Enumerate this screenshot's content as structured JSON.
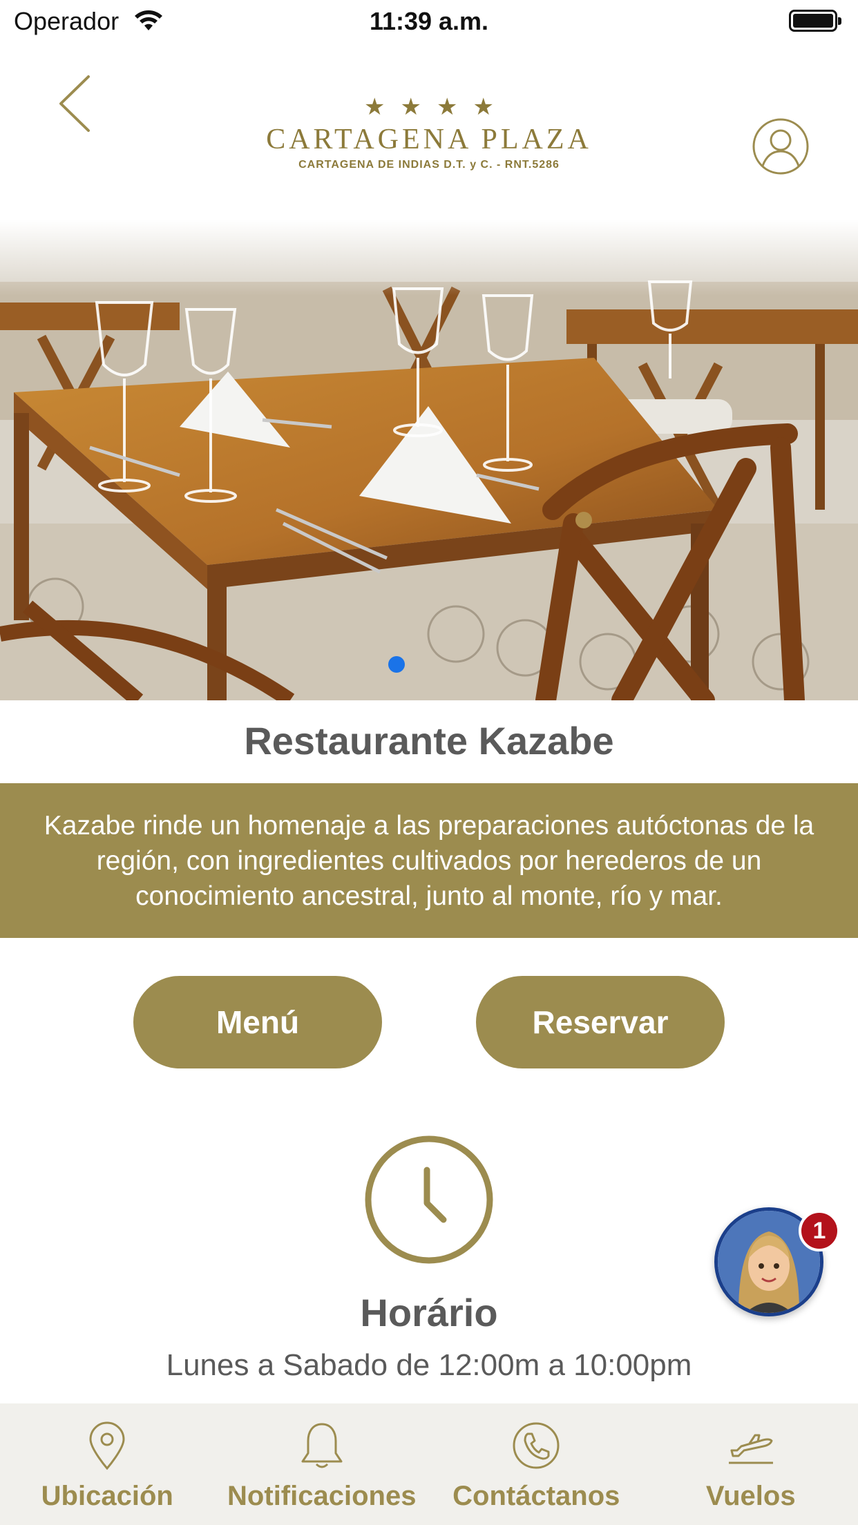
{
  "status_bar": {
    "carrier": "Operador",
    "time": "11:39 a.m."
  },
  "header": {
    "logo": {
      "stars": "★★★★",
      "name": "CARTAGENA PLAZA",
      "subtitle": "CARTAGENA DE INDIAS D.T. y C. - RNT.5286"
    }
  },
  "hero": {
    "page_index": 1,
    "page_count": 1
  },
  "restaurant": {
    "title": "Restaurante Kazabe",
    "description": "Kazabe rinde un homenaje a las preparaciones autóctonas de la región, con ingredientes cultivados por herederos de un conocimiento ancestral, junto al monte, río y mar."
  },
  "actions": {
    "menu_label": "Menú",
    "reserve_label": "Reservar"
  },
  "schedule": {
    "title": "Horário",
    "hours": "Lunes a Sabado de 12:00m a 10:00pm"
  },
  "chat": {
    "badge_count": "1"
  },
  "bottom_nav": {
    "items": [
      {
        "label": "Ubicación",
        "icon": "location-pin-icon"
      },
      {
        "label": "Notificaciones",
        "icon": "bell-icon"
      },
      {
        "label": "Contáctanos",
        "icon": "phone-icon"
      },
      {
        "label": "Vuelos",
        "icon": "airplane-icon"
      }
    ]
  },
  "colors": {
    "brand_gold": "#9c8c4f",
    "logo_gold": "#8c7a3a",
    "text_gray": "#5a5a5a",
    "nav_background": "#f1f0ec",
    "page_dot": "#1a73e8",
    "badge_red": "#b3121b"
  }
}
